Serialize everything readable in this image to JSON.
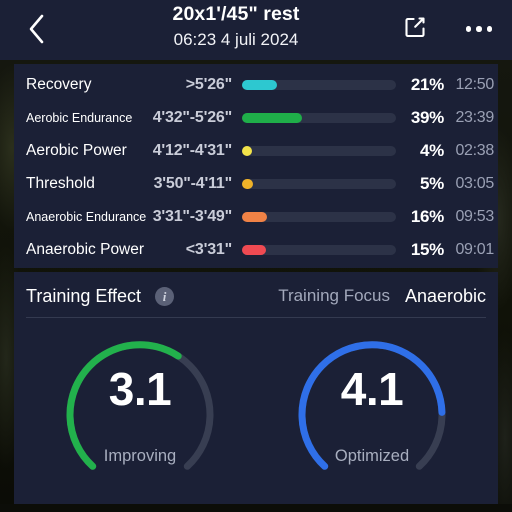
{
  "header": {
    "back_icon": "chevron-left-icon",
    "title": "20x1'/45\" rest",
    "subtitle": "06:23 4 juli 2024",
    "share_icon": "share-external-icon",
    "more_icon": "more-horizontal-icon"
  },
  "zones_card": {
    "rows": [
      {
        "name": "Recovery",
        "name_size": "normal",
        "range": ">5'26\"",
        "percent": "21%",
        "fill_ratio": 0.23,
        "time": "12:50",
        "color": "#2dc8d0"
      },
      {
        "name": "Aerobic Endurance",
        "name_size": "small",
        "range": "4'32\"-5'26\"",
        "percent": "39%",
        "fill_ratio": 0.39,
        "time": "23:39",
        "color": "#1fae49"
      },
      {
        "name": "Aerobic Power",
        "name_size": "normal",
        "range": "4'12\"-4'31\"",
        "percent": "4%",
        "fill_ratio": 0.065,
        "time": "02:38",
        "color": "#f2e34a"
      },
      {
        "name": "Threshold",
        "name_size": "normal",
        "range": "3'50\"-4'11\"",
        "percent": "5%",
        "fill_ratio": 0.07,
        "time": "03:05",
        "color": "#efb229"
      },
      {
        "name": "Anaerobic Endurance",
        "name_size": "small",
        "range": "3'31\"-3'49\"",
        "percent": "16%",
        "fill_ratio": 0.165,
        "time": "09:53",
        "color": "#f08246"
      },
      {
        "name": "Anaerobic Power",
        "name_size": "normal",
        "range": "<3'31\"",
        "percent": "15%",
        "fill_ratio": 0.155,
        "time": "09:01",
        "color": "#ef4a52"
      }
    ],
    "track_color": "#2c3247"
  },
  "training_effect": {
    "title": "Training Effect",
    "info_icon": "info-circle-icon",
    "info_glyph": "i",
    "focus_label": "Training Focus",
    "focus_value": "Anaerobic",
    "gauges": [
      {
        "value": "3.1",
        "label": "Improving",
        "fraction": 0.62,
        "color": "#22b14c",
        "track_color": "#383e52"
      },
      {
        "value": "4.1",
        "label": "Optimized",
        "fraction": 0.82,
        "color": "#2f6fe8",
        "track_color": "#383e52"
      }
    ]
  },
  "theme": {
    "card_bg": "#1b2036",
    "topbar_bg": "#1b2036",
    "text_primary": "#ffffff",
    "text_secondary": "#9aa0b4"
  }
}
